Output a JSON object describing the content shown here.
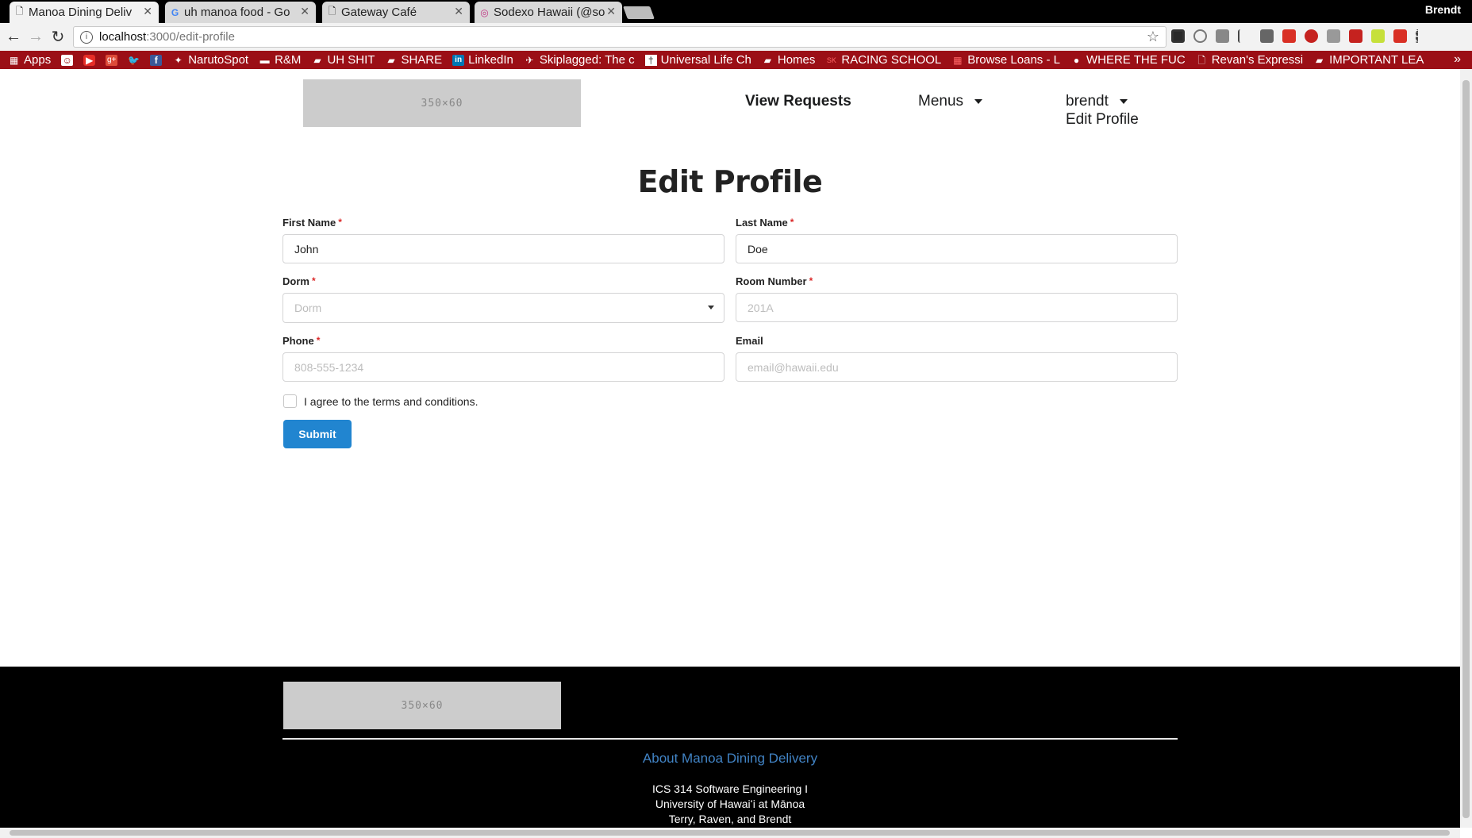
{
  "browser": {
    "tabs": [
      {
        "title": "Manoa Dining Deliv",
        "active": true
      },
      {
        "title": "uh manoa food - Go",
        "active": false
      },
      {
        "title": "Gateway Café",
        "active": false
      },
      {
        "title": "Sodexo Hawaii (@so",
        "active": false
      }
    ],
    "profile": "Brendt",
    "url_host": "localhost",
    "url_path": ":3000/edit-profile",
    "bookmarks": [
      "Apps",
      "",
      "",
      "",
      "",
      "",
      "NarutoSpot",
      "R&M",
      "UH SHIT",
      "SHARE",
      "LinkedIn",
      "Skiplagged: The c",
      "Universal Life Ch",
      "Homes",
      "RACING SCHOOL",
      "Browse Loans - L",
      "WHERE THE FUC",
      "Revan's Expressi",
      "IMPORTANT LEA"
    ],
    "bookmarks_more": "»"
  },
  "header": {
    "logo_text": "350×60",
    "nav": {
      "view_requests": "View Requests",
      "menus": "Menus",
      "user": "brendt",
      "edit_profile": "Edit Profile"
    }
  },
  "form": {
    "title": "Edit Profile",
    "first_name": {
      "label": "First Name",
      "value": "John"
    },
    "last_name": {
      "label": "Last Name",
      "value": "Doe"
    },
    "dorm": {
      "label": "Dorm",
      "placeholder": "Dorm"
    },
    "room": {
      "label": "Room Number",
      "placeholder": "201A"
    },
    "phone": {
      "label": "Phone",
      "placeholder": "808-555-1234"
    },
    "email": {
      "label": "Email",
      "placeholder": "email@hawaii.edu"
    },
    "required_mark": "*",
    "terms_label": "I agree to the terms and conditions.",
    "terms_checked": false,
    "submit_label": "Submit"
  },
  "footer": {
    "logo_text": "350×60",
    "about_link": "About Manoa Dining Delivery",
    "lines": [
      "ICS 314 Software Engineering I",
      "University of Hawaiʻi at Mānoa",
      "Terry, Raven, and Brendt"
    ]
  },
  "colors": {
    "accent": "#2185d0",
    "link": "#4183c4",
    "required": "#db2828",
    "bookmark_bar": "#9b0f16"
  }
}
